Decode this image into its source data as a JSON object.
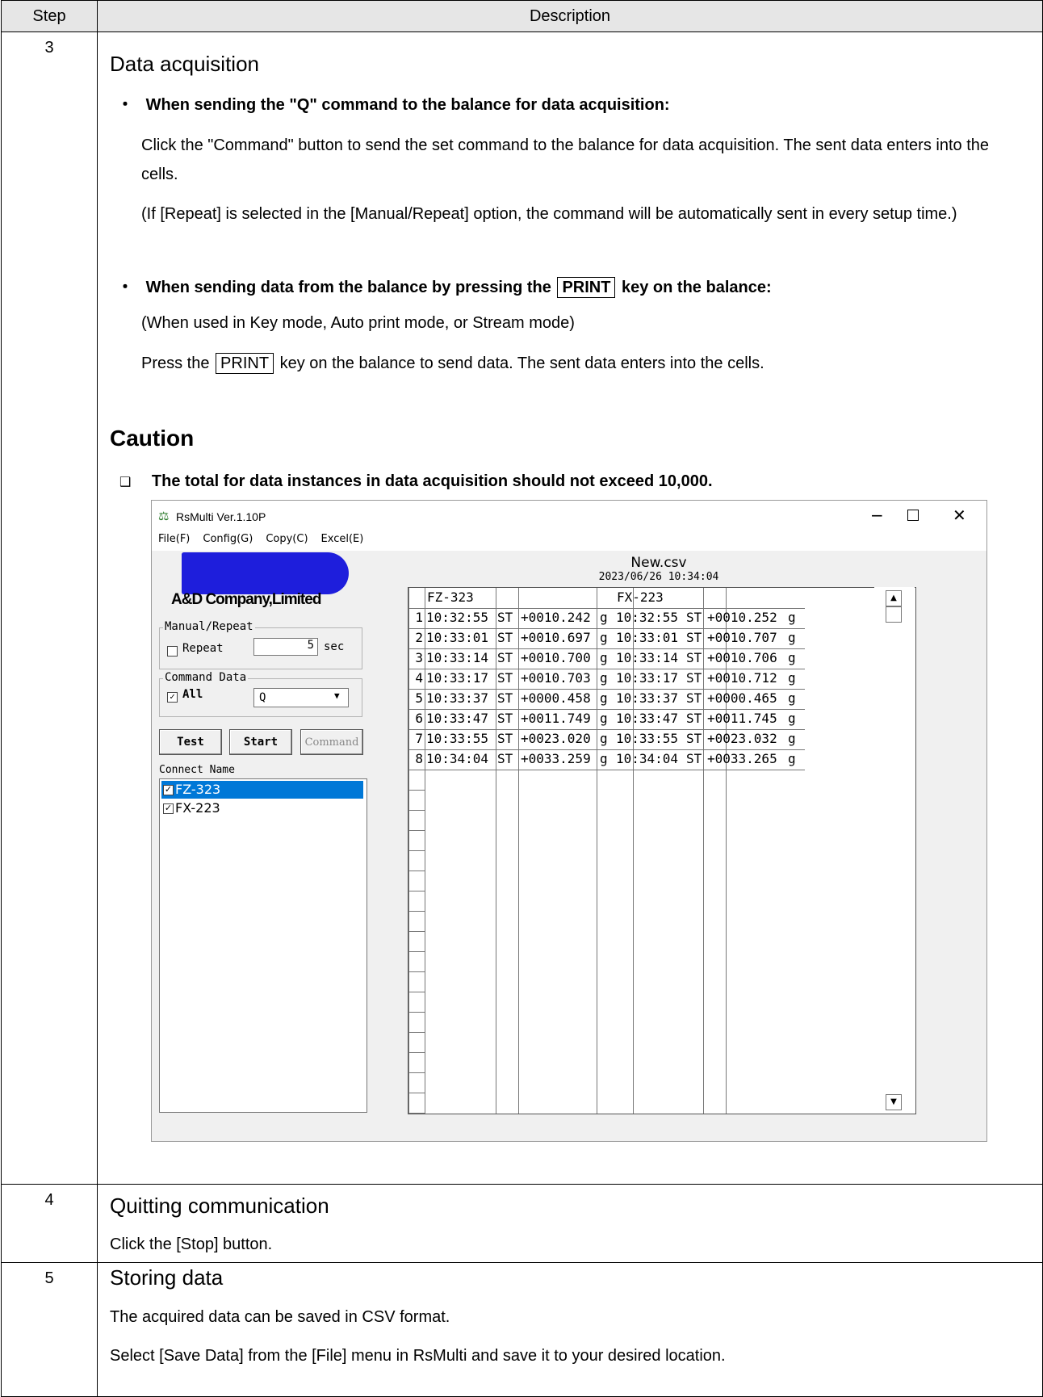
{
  "table": {
    "header_step": "Step",
    "header_description": "Description"
  },
  "step3": {
    "num": "3",
    "title": "Data acquisition",
    "bullet1_marker": "・",
    "bullet1_heading": "When sending the \"Q\" command to the balance for data acquisition:",
    "bullet1_text": "Click the \"Command\" button to send the set command to the balance for data acquisition. The sent data enters into the cells.",
    "bullet1_note": "(If [Repeat] is selected in the [Manual/Repeat] option, the command will be automatically sent in every setup time.)",
    "bullet2_marker": "・",
    "bullet2_heading_pre": "When sending data from the balance by pressing the",
    "bullet2_key": "PRINT",
    "bullet2_heading_post": "key on the balance:",
    "bullet2_mode": "(When used in Key mode, Auto print mode, or Stream mode)",
    "bullet2_text_pre": "Press the",
    "bullet2_key2": "PRINT",
    "bullet2_text_post": "key on the balance to send data. The sent data enters into the cells.",
    "caution_title": "Caution",
    "caution_marker": "❑",
    "caution_text": "The total for data instances in data acquisition should not exceed 10,000."
  },
  "app": {
    "window_title": "RsMulti Ver.1.10P",
    "menu": [
      "File(F)",
      "Config(G)",
      "Copy(C)",
      "Excel(E)"
    ],
    "logo_text": "A&D Company,Limited",
    "manual_repeat_label": "Manual/Repeat",
    "repeat_label": "Repeat",
    "repeat_value": "5",
    "repeat_unit": "sec",
    "command_data_label": "Command Data",
    "all_label": "All",
    "command_select_value": "Q",
    "test_button": "Test",
    "start_button": "Start",
    "command_button": "Command",
    "connect_name_label": "Connect Name",
    "connections": [
      "FZ-323",
      "FX-223"
    ],
    "file_name": "New.csv",
    "file_timestamp": "2023/06/26 10:34:04",
    "grid_headers": [
      "FZ-323",
      "FX-223"
    ],
    "rows": [
      {
        "n": "1",
        "t1": "10:32:55",
        "s1": "ST",
        "v1": "+0010.242",
        "u1": "g",
        "t2": "10:32:55",
        "s2": "ST",
        "v2": "+0010.252",
        "u2": "g"
      },
      {
        "n": "2",
        "t1": "10:33:01",
        "s1": "ST",
        "v1": "+0010.697",
        "u1": "g",
        "t2": "10:33:01",
        "s2": "ST",
        "v2": "+0010.707",
        "u2": "g"
      },
      {
        "n": "3",
        "t1": "10:33:14",
        "s1": "ST",
        "v1": "+0010.700",
        "u1": "g",
        "t2": "10:33:14",
        "s2": "ST",
        "v2": "+0010.706",
        "u2": "g"
      },
      {
        "n": "4",
        "t1": "10:33:17",
        "s1": "ST",
        "v1": "+0010.703",
        "u1": "g",
        "t2": "10:33:17",
        "s2": "ST",
        "v2": "+0010.712",
        "u2": "g"
      },
      {
        "n": "5",
        "t1": "10:33:37",
        "s1": "ST",
        "v1": "+0000.458",
        "u1": "g",
        "t2": "10:33:37",
        "s2": "ST",
        "v2": "+0000.465",
        "u2": "g"
      },
      {
        "n": "6",
        "t1": "10:33:47",
        "s1": "ST",
        "v1": "+0011.749",
        "u1": "g",
        "t2": "10:33:47",
        "s2": "ST",
        "v2": "+0011.745",
        "u2": "g"
      },
      {
        "n": "7",
        "t1": "10:33:55",
        "s1": "ST",
        "v1": "+0023.020",
        "u1": "g",
        "t2": "10:33:55",
        "s2": "ST",
        "v2": "+0023.032",
        "u2": "g"
      },
      {
        "n": "8",
        "t1": "10:34:04",
        "s1": "ST",
        "v1": "+0033.259",
        "u1": "g",
        "t2": "10:34:04",
        "s2": "ST",
        "v2": "+0033.265",
        "u2": "g"
      }
    ]
  },
  "step4": {
    "num": "4",
    "title": "Quitting communication",
    "text": "Click the [Stop] button."
  },
  "step5": {
    "num": "5",
    "title": "Storing data",
    "text1": "The acquired data can be saved in CSV format.",
    "text2": "Select [Save Data] from the  [File] menu in RsMulti and save it to your desired location."
  }
}
